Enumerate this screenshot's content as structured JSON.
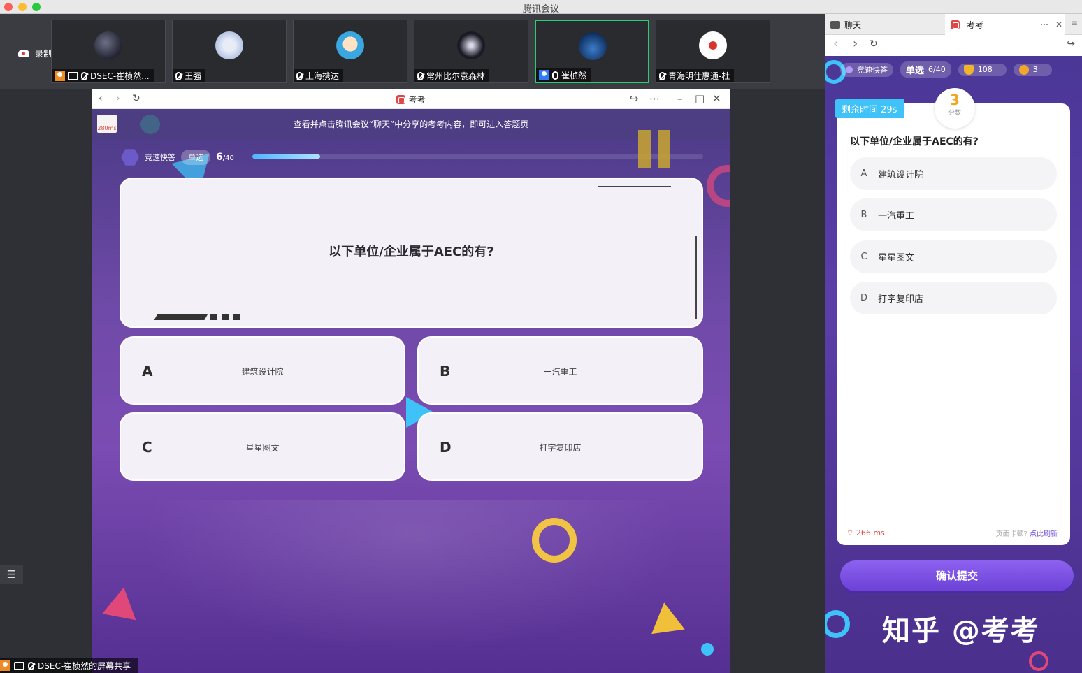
{
  "window": {
    "title": "腾讯会议"
  },
  "meeting": {
    "recording_label": "录制中",
    "participants": [
      {
        "name": "DSEC-崔桢然..."
      },
      {
        "name": "王强"
      },
      {
        "name": "上海携达"
      },
      {
        "name": "常州比尔袁森林"
      },
      {
        "name": "崔桢然"
      },
      {
        "name": "青海明仕惠通-杜"
      }
    ],
    "screen_share_label": "DSEC-崔桢然的屏幕共享"
  },
  "kaokao_window": {
    "title": "考考",
    "banner": "查看并点击腾讯会议“聊天”中分享的考考内容，即可进入答题页",
    "latency": "280ms",
    "mode": "竞速快答",
    "type": "单选",
    "progress_current": "6",
    "progress_total": "/40",
    "progress_fraction": 0.15,
    "question": "以下单位/企业属于AEC的有?",
    "options": [
      {
        "letter": "A",
        "text": "建筑设计院"
      },
      {
        "letter": "B",
        "text": "一汽重工"
      },
      {
        "letter": "C",
        "text": "星星图文"
      },
      {
        "letter": "D",
        "text": "打字复印店"
      }
    ]
  },
  "right_panel": {
    "tabs": [
      {
        "label": "聊天"
      },
      {
        "label": "考考"
      }
    ],
    "mode": "竞速快答",
    "type": "单选",
    "progress": "6/40",
    "trophy_count": "108",
    "medal_count": "3",
    "timer": "剩余时间 29s",
    "score": "3",
    "score_label": "分数",
    "question": "以下单位/企业属于AEC的有?",
    "options": [
      {
        "letter": "A",
        "text": "建筑设计院"
      },
      {
        "letter": "B",
        "text": "一汽重工"
      },
      {
        "letter": "C",
        "text": "星星图文"
      },
      {
        "letter": "D",
        "text": "打字复印店"
      }
    ],
    "latency": "266 ms",
    "stuck_hint": "页面卡顿?",
    "refresh_link": "点此刷新",
    "submit_label": "确认提交",
    "watermark": "知乎 @考考"
  },
  "colors": {
    "accent": "#6b41d6",
    "timer": "#3ec2f7",
    "score": "#f0a623",
    "active_tile": "#2ecc71"
  }
}
